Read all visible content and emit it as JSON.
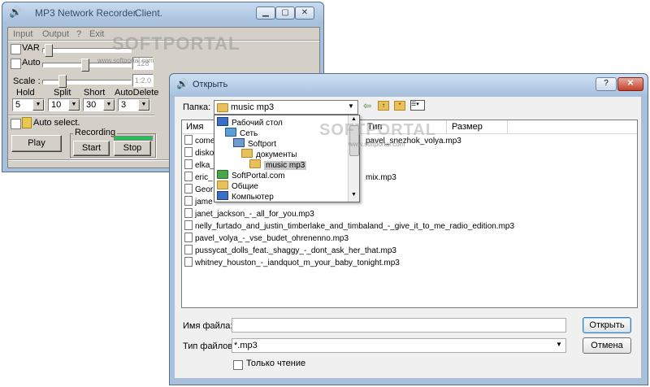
{
  "recorder": {
    "title": "MP3 Network Recorder.",
    "subtitle": "Client.",
    "menu": [
      "Input",
      "Output",
      "?",
      "Exit"
    ],
    "var_label": "VAR",
    "auto_label": "Auto",
    "auto_value": "128",
    "scale_label": "Scale :",
    "scale_value": "1:2.0",
    "hold_label": "Hold",
    "split_label": "Split",
    "short_label": "Short",
    "autodelete_label": "AutoDelete",
    "hold_value": "5",
    "split_value": "10",
    "short_value": "30",
    "autodelete_value": "3",
    "auto_select_label": "Auto select.",
    "recording_label": "Recording",
    "play_label": "Play",
    "start_label": "Start",
    "stop_label": "Stop",
    "level_color": "#22c05a"
  },
  "watermark": {
    "brand": "SOFTPORTAL",
    "url": "www.softportal.com"
  },
  "dialog": {
    "title": "Открыть",
    "folder_label": "Папка:",
    "current_folder": "music mp3",
    "columns": {
      "name": "Имя",
      "type": "Тип",
      "size": "Размер"
    },
    "tree": [
      {
        "label": "Рабочий стол",
        "icon": "desktop-icon"
      },
      {
        "label": "Сеть",
        "icon": "network-icon"
      },
      {
        "label": "Softport",
        "icon": "computer-icon"
      },
      {
        "label": "документы",
        "icon": "folder-icon"
      },
      {
        "label": "music mp3",
        "icon": "folder-icon"
      },
      {
        "label": "SoftPortal.com",
        "icon": "folder-icon"
      },
      {
        "label": "Общие",
        "icon": "folder-icon"
      },
      {
        "label": "Компьютер",
        "icon": "computer-icon"
      }
    ],
    "hidden_partial_files": [
      "come",
      "disko",
      "elka_",
      "eric_",
      "Geor",
      "jame"
    ],
    "file_right_parts": [
      "pavel_snezhok_volya.mp3",
      "mix.mp3"
    ],
    "files": [
      "janet_jackson_-_all_for_you.mp3",
      "nelly_furtado_and_justin_timberlake_and_timbaland_-_give_it_to_me_radio_edition.mp3",
      "pavel_volya_-_vse_budet_ohrenenno.mp3",
      "pussycat_dolls_feat._shaggy_-_dont_ask_her_that.mp3",
      "whitney_houston_-_iandquot_m_your_baby_tonight.mp3"
    ],
    "filename_label": "Имя файла:",
    "filename_value": "",
    "filetype_label": "Тип файлов:",
    "filetype_value": "*.mp3",
    "readonly_label": "Только чтение",
    "open_label": "Открыть",
    "cancel_label": "Отмена"
  }
}
